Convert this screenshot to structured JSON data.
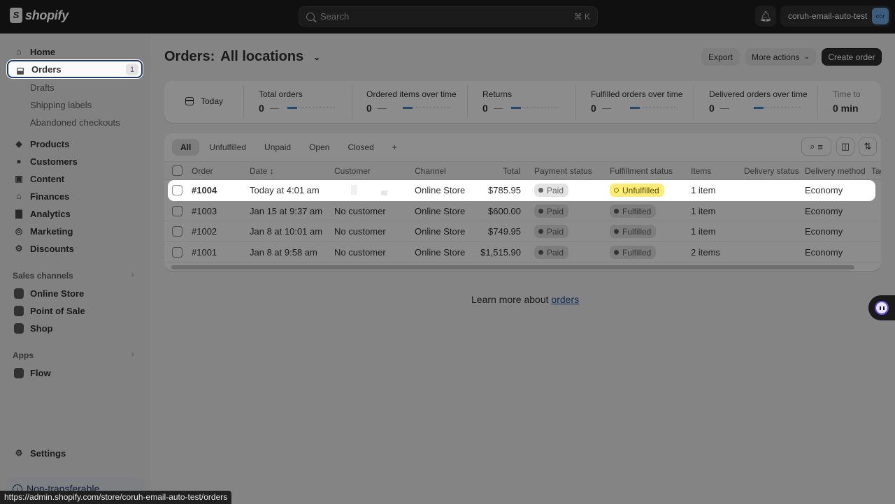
{
  "topbar": {
    "brand": "shopify",
    "search_placeholder": "Search",
    "search_shortcut": "⌘ K",
    "store_name": "coruh-email-auto-test",
    "avatar_initials": "cor",
    "icons": {
      "bell": "bell-icon",
      "search": "search-icon"
    }
  },
  "sidebar": {
    "items": [
      {
        "label": "Home",
        "icon": "home-icon"
      },
      {
        "label": "Orders",
        "icon": "inbox-icon",
        "badge": "1",
        "active": true
      },
      {
        "label": "Drafts",
        "sub": true
      },
      {
        "label": "Shipping labels",
        "sub": true
      },
      {
        "label": "Abandoned checkouts",
        "sub": true
      },
      {
        "label": "Products",
        "icon": "tag-icon"
      },
      {
        "label": "Customers",
        "icon": "person-icon"
      },
      {
        "label": "Content",
        "icon": "image-icon"
      },
      {
        "label": "Finances",
        "icon": "bank-icon"
      },
      {
        "label": "Analytics",
        "icon": "bar-chart-icon"
      },
      {
        "label": "Marketing",
        "icon": "target-icon"
      },
      {
        "label": "Discounts",
        "icon": "discount-icon"
      }
    ],
    "sales_channels_label": "Sales channels",
    "sales_channels": [
      {
        "label": "Online Store",
        "icon": "store-icon"
      },
      {
        "label": "Point of Sale",
        "icon": "pos-icon"
      },
      {
        "label": "Shop",
        "icon": "shop-icon"
      }
    ],
    "apps_label": "Apps",
    "apps": [
      {
        "label": "Flow",
        "icon": "flow-icon"
      }
    ],
    "settings_label": "Settings",
    "non_transferable": "Non-transferable"
  },
  "status_url": "https://admin.shopify.com/store/coruh-email-auto-test/orders",
  "page": {
    "title_prefix": "Orders:",
    "title_location": "All locations",
    "export_label": "Export",
    "more_actions_label": "More actions",
    "create_order_label": "Create order"
  },
  "metrics": {
    "date_range": "Today",
    "items": [
      {
        "label": "Total orders",
        "value": "0",
        "trend": "—"
      },
      {
        "label": "Ordered items over time",
        "value": "0",
        "trend": "—"
      },
      {
        "label": "Returns",
        "value": "0",
        "trend": "—"
      },
      {
        "label": "Fulfilled orders over time",
        "value": "0",
        "trend": "—"
      },
      {
        "label": "Delivered orders over time",
        "value": "0",
        "trend": "—"
      },
      {
        "label": "Time to",
        "value": "0 min",
        "trend": ""
      }
    ]
  },
  "orders": {
    "tabs": [
      "All",
      "Unfulfilled",
      "Unpaid",
      "Open",
      "Closed",
      "+"
    ],
    "active_tab": "All",
    "columns": [
      "Order",
      "Date",
      "Customer",
      "Channel",
      "Total",
      "Payment status",
      "Fulfillment status",
      "Items",
      "Delivery status",
      "Delivery method",
      "Tags"
    ],
    "rows": [
      {
        "order": "#1004",
        "date": "Today at 4:01 am",
        "customer": "",
        "channel": "Online Store",
        "total": "$785.95",
        "payment": "Paid",
        "fulfillment": "Unfulfilled",
        "items": "1 item",
        "delivery_status": "",
        "delivery_method": "Economy",
        "highlighted": true
      },
      {
        "order": "#1003",
        "date": "Jan 15 at 9:37 am",
        "customer": "No customer",
        "channel": "Online Store",
        "total": "$600.00",
        "payment": "Paid",
        "fulfillment": "Fulfilled",
        "items": "1 item",
        "delivery_status": "",
        "delivery_method": "Economy"
      },
      {
        "order": "#1002",
        "date": "Jan 8 at 10:01 am",
        "customer": "No customer",
        "channel": "Online Store",
        "total": "$749.95",
        "payment": "Paid",
        "fulfillment": "Fulfilled",
        "items": "1 item",
        "delivery_status": "",
        "delivery_method": "Economy"
      },
      {
        "order": "#1001",
        "date": "Jan 8 at 9:58 am",
        "customer": "No customer",
        "channel": "Online Store",
        "total": "$1,515.90",
        "payment": "Paid",
        "fulfillment": "Fulfilled",
        "items": "2 items",
        "delivery_status": "",
        "delivery_method": "Economy"
      }
    ]
  },
  "footer": {
    "learn_prefix": "Learn more about",
    "learn_link": "orders"
  },
  "colors": {
    "unfulfilled_badge": "#ffeb78",
    "focus_ring": "#1e3a6b",
    "link": "#1f5199",
    "primary_button": "#303030"
  }
}
